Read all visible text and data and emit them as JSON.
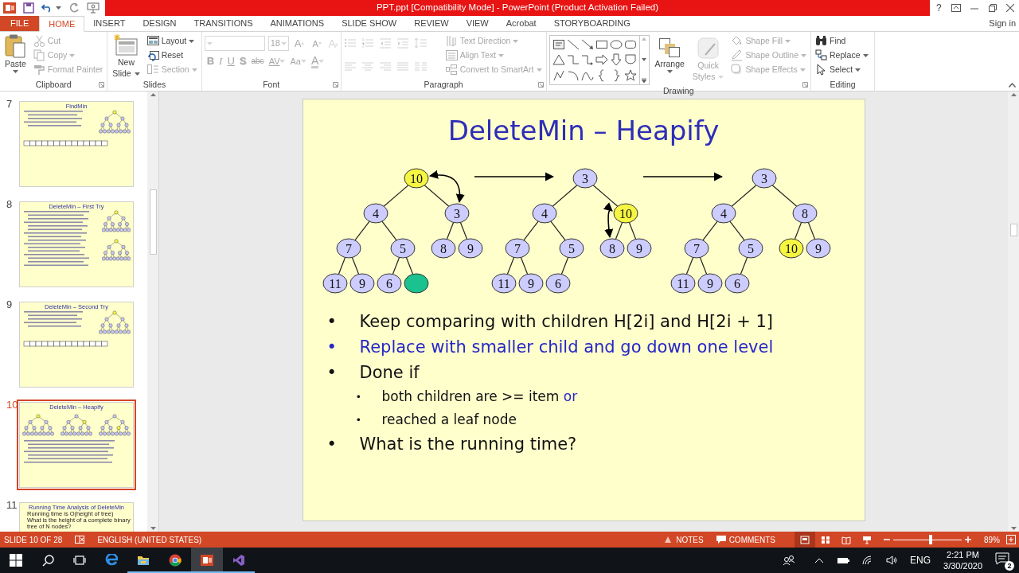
{
  "window": {
    "title": "PPT.ppt [Compatibility Mode] -  PowerPoint (Product Activation Failed)",
    "help": "?"
  },
  "ribbon_tabs": [
    {
      "label": "FILE",
      "kind": "file",
      "selected": false
    },
    {
      "label": "HOME",
      "kind": "tab",
      "selected": true
    },
    {
      "label": "INSERT",
      "kind": "tab",
      "selected": false
    },
    {
      "label": "DESIGN",
      "kind": "tab",
      "selected": false
    },
    {
      "label": "TRANSITIONS",
      "kind": "tab",
      "selected": false
    },
    {
      "label": "ANIMATIONS",
      "kind": "tab",
      "selected": false
    },
    {
      "label": "SLIDE SHOW",
      "kind": "tab",
      "selected": false
    },
    {
      "label": "REVIEW",
      "kind": "tab",
      "selected": false
    },
    {
      "label": "VIEW",
      "kind": "tab",
      "selected": false
    },
    {
      "label": "Acrobat",
      "kind": "tab",
      "selected": false
    },
    {
      "label": "STORYBOARDING",
      "kind": "tab",
      "selected": false
    }
  ],
  "account": "Sign in",
  "clipboard": {
    "label": "Clipboard",
    "paste": {
      "label": "Paste",
      "disabled": false
    },
    "items": [
      {
        "kind": "cut",
        "label": "Cut",
        "disabled": true,
        "dropdown": false
      },
      {
        "kind": "copy",
        "label": "Copy",
        "disabled": true,
        "dropdown": true
      },
      {
        "kind": "painter",
        "label": "Format Painter",
        "disabled": true,
        "dropdown": false
      }
    ]
  },
  "slides_group": {
    "label": "Slides",
    "new_slide": {
      "label": "New",
      "label_2": "Slide",
      "disabled": false
    },
    "items": [
      {
        "kind": "layout",
        "label": "Layout",
        "disabled": false,
        "dropdown": true
      },
      {
        "kind": "reset",
        "label": "Reset",
        "disabled": false,
        "dropdown": false
      },
      {
        "kind": "section",
        "label": "Section",
        "disabled": true,
        "dropdown": true
      }
    ]
  },
  "font": {
    "label": "Font",
    "disabled": true,
    "size": "18",
    "grow": "A",
    "shrink": "A",
    "buttons": [
      {
        "kind": "bold",
        "label": "B"
      },
      {
        "kind": "italic",
        "label": "I"
      },
      {
        "kind": "underline",
        "label": "U"
      },
      {
        "kind": "shadow",
        "label": "S"
      },
      {
        "kind": "strike",
        "label": "abc"
      },
      {
        "kind": "spacing",
        "label": "AV"
      },
      {
        "kind": "case",
        "label": "Aa"
      },
      {
        "kind": "color",
        "label": "A"
      }
    ]
  },
  "paragraph": {
    "label": "Paragraph",
    "disabled": true,
    "items": [
      {
        "kind": "direction",
        "label": "Text Direction",
        "dropdown": true
      },
      {
        "kind": "align",
        "label": "Align Text",
        "dropdown": true
      },
      {
        "kind": "smartart",
        "label": "Convert to SmartArt",
        "dropdown": true
      }
    ]
  },
  "drawing": {
    "label": "Drawing",
    "arrange": {
      "label": "Arrange",
      "disabled": false
    },
    "quick_styles": {
      "label": "Quick",
      "label_2": "Styles",
      "disabled": true
    },
    "items": [
      {
        "kind": "fill",
        "label": "Shape Fill",
        "disabled": true
      },
      {
        "kind": "outline",
        "label": "Shape Outline",
        "disabled": true
      },
      {
        "kind": "effects",
        "label": "Shape Effects",
        "disabled": true
      }
    ]
  },
  "editing": {
    "label": "Editing",
    "items": [
      {
        "kind": "find",
        "label": "Find",
        "dropdown": false
      },
      {
        "kind": "replace",
        "label": "Replace",
        "dropdown": true
      },
      {
        "kind": "select",
        "label": "Select",
        "dropdown": true
      }
    ]
  },
  "thumbnails": [
    {
      "number": "7",
      "title": "FindMin",
      "selected": false,
      "kind": "tree_array"
    },
    {
      "number": "8",
      "title": "DeleteMin – First Try",
      "selected": false,
      "kind": "two_trees"
    },
    {
      "number": "9",
      "title": "DeleteMin – Second Try",
      "selected": false,
      "kind": "tree_array"
    },
    {
      "number": "10",
      "title": "DeleteMin – Heapify",
      "selected": true,
      "kind": "three_trees"
    },
    {
      "number": "11",
      "title": "Running Time Analysis of DeleteMin",
      "selected": false,
      "bullets": [
        {
          "text": "Running time is O(height of tree)"
        },
        {
          "text": "What is the height of a complete binary tree of N nodes?"
        }
      ]
    }
  ],
  "slide": {
    "title": "DeleteMin – Heapify",
    "trees": [
      {
        "root": {
          "value": "10",
          "color": "#f6f542",
          "children": [
            {
              "value": "4",
              "color": "#ccccff",
              "children": [
                {
                  "value": "7",
                  "color": "#ccccff",
                  "children": [
                    {
                      "value": "11",
                      "color": "#ccccff"
                    },
                    {
                      "value": "9",
                      "color": "#ccccff"
                    }
                  ]
                },
                {
                  "value": "5",
                  "color": "#ccccff",
                  "children": [
                    {
                      "value": "6",
                      "color": "#ccccff"
                    },
                    {
                      "color": "#19c28e"
                    }
                  ]
                }
              ]
            },
            {
              "value": "3",
              "color": "#ccccff",
              "swap_with_parent": true,
              "children": [
                {
                  "value": "8",
                  "color": "#ccccff"
                },
                {
                  "value": "9",
                  "color": "#ccccff"
                }
              ]
            }
          ]
        }
      },
      {
        "root": {
          "value": "3",
          "color": "#ccccff",
          "children": [
            {
              "value": "4",
              "color": "#ccccff",
              "children": [
                {
                  "value": "7",
                  "color": "#ccccff",
                  "children": [
                    {
                      "value": "11",
                      "color": "#ccccff"
                    },
                    {
                      "value": "9",
                      "color": "#ccccff"
                    }
                  ]
                },
                {
                  "value": "5",
                  "color": "#ccccff",
                  "children": [
                    {
                      "value": "6",
                      "color": "#ccccff"
                    }
                  ]
                }
              ]
            },
            {
              "value": "10",
              "color": "#f6f542",
              "children": [
                {
                  "value": "8",
                  "color": "#ccccff",
                  "swap_with_parent": true
                },
                {
                  "value": "9",
                  "color": "#ccccff"
                }
              ]
            }
          ]
        }
      },
      {
        "root": {
          "value": "3",
          "color": "#ccccff",
          "children": [
            {
              "value": "4",
              "color": "#ccccff",
              "children": [
                {
                  "value": "7",
                  "color": "#ccccff",
                  "children": [
                    {
                      "value": "11",
                      "color": "#ccccff"
                    },
                    {
                      "value": "9",
                      "color": "#ccccff"
                    }
                  ]
                },
                {
                  "value": "5",
                  "color": "#ccccff",
                  "children": [
                    {
                      "value": "6",
                      "color": "#ccccff"
                    }
                  ]
                }
              ]
            },
            {
              "value": "8",
              "color": "#ccccff",
              "children": [
                {
                  "value": "10",
                  "color": "#f6f542"
                },
                {
                  "value": "9",
                  "color": "#ccccff"
                }
              ]
            }
          ]
        }
      }
    ],
    "bullets": [
      {
        "marker": "•",
        "parts": [
          {
            "text": "Keep comparing with children H[2i] and H[2i + 1]"
          }
        ]
      },
      {
        "marker": "•",
        "parts": [
          {
            "text": "Replace with smaller child and go down one level",
            "color": "#2626c9"
          }
        ]
      },
      {
        "marker": "•",
        "parts": [
          {
            "text": "Done if"
          }
        ],
        "children": [
          {
            "marker": "•",
            "parts": [
              {
                "text": "both children are >= item "
              },
              {
                "text": "or",
                "color": "#2626c9"
              }
            ]
          },
          {
            "marker": "•",
            "parts": [
              {
                "text": "reached a leaf node"
              }
            ]
          }
        ]
      },
      {
        "marker": "•",
        "parts": [
          {
            "text": "What is the running time?"
          }
        ]
      }
    ]
  },
  "status_bar": {
    "slide_info": "SLIDE 10 OF 28",
    "language": "ENGLISH (UNITED STATES)",
    "notes": "NOTES",
    "comments": "COMMENTS",
    "views": [
      {
        "kind": "normal",
        "selected": true
      },
      {
        "kind": "sorter",
        "selected": false
      },
      {
        "kind": "reading",
        "selected": false
      },
      {
        "kind": "show",
        "selected": false
      }
    ],
    "zoom": {
      "level": 0.55,
      "reading": "89%"
    }
  },
  "taskbar": {
    "apps": [
      {
        "kind": "search",
        "running": false,
        "selected": false
      },
      {
        "kind": "taskview",
        "running": false,
        "selected": false
      },
      {
        "kind": "browser",
        "running": false,
        "selected": false
      },
      {
        "kind": "folder",
        "running": true,
        "selected": false
      },
      {
        "kind": "chrome",
        "running": true,
        "selected": false
      },
      {
        "kind": "slides",
        "running": true,
        "selected": true
      },
      {
        "kind": "ide",
        "running": true,
        "selected": false
      }
    ],
    "language": "ENG",
    "time": "2:21 PM",
    "date": "3/30/2020",
    "notifications": "2"
  }
}
